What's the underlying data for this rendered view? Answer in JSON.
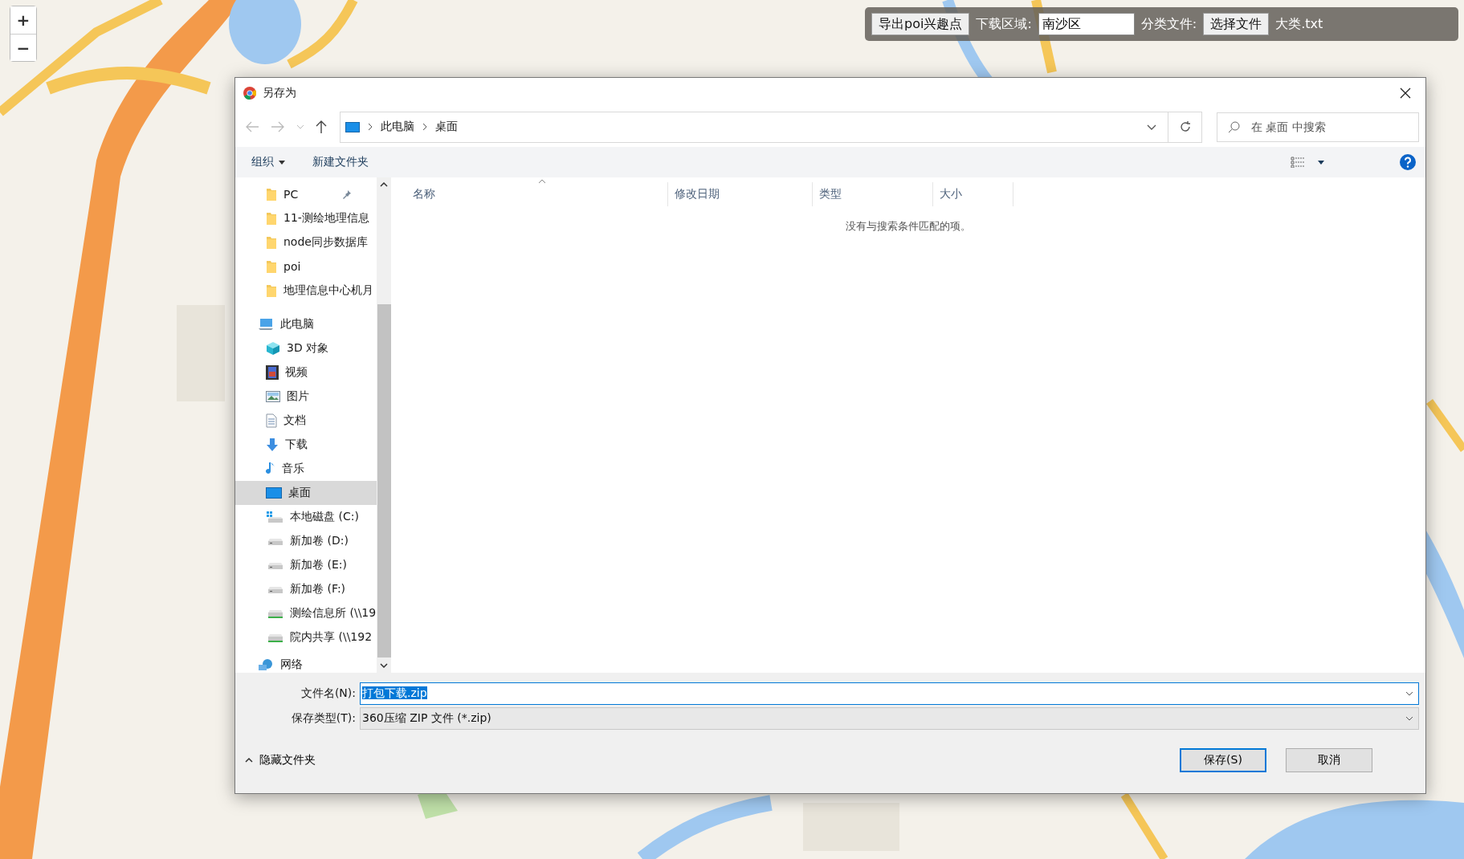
{
  "map_controls": {
    "zoom_in": "+",
    "zoom_out": "−"
  },
  "toolbar": {
    "export_button": "导出poi兴趣点",
    "region_label": "下载区域:",
    "region_value": "南沙区",
    "category_label": "分类文件:",
    "choose_button": "选择文件",
    "file_name": "大类.txt"
  },
  "dialog": {
    "title": "另存为",
    "breadcrumb": [
      "此电脑",
      "桌面"
    ],
    "search": {
      "placeholder": "在 桌面 中搜索"
    },
    "commands": {
      "organize": "组织",
      "new_folder": "新建文件夹"
    },
    "quick_access": [
      {
        "label": "PC",
        "kind": "folder",
        "pinned": true,
        "selected": false
      },
      {
        "label": "11-测绘地理信息",
        "kind": "folder",
        "pinned": false,
        "selected": false
      },
      {
        "label": "node同步数据库",
        "kind": "folder",
        "pinned": false,
        "selected": false
      },
      {
        "label": "poi",
        "kind": "folder",
        "pinned": false,
        "selected": false
      },
      {
        "label": "地理信息中心机月",
        "kind": "folder",
        "pinned": false,
        "selected": false
      }
    ],
    "tree": [
      {
        "label": "此电脑",
        "kind": "computer",
        "selected": false,
        "children": [
          {
            "label": "3D 对象",
            "kind": "cube",
            "selected": false
          },
          {
            "label": "视频",
            "kind": "video",
            "selected": false
          },
          {
            "label": "图片",
            "kind": "picture",
            "selected": false
          },
          {
            "label": "文档",
            "kind": "document",
            "selected": false
          },
          {
            "label": "下载",
            "kind": "download",
            "selected": false
          },
          {
            "label": "音乐",
            "kind": "music",
            "selected": false
          },
          {
            "label": "桌面",
            "kind": "desktop",
            "selected": true
          },
          {
            "label": "本地磁盘 (C:)",
            "kind": "system-drive",
            "selected": false
          },
          {
            "label": "新加卷 (D:)",
            "kind": "drive",
            "selected": false
          },
          {
            "label": "新加卷 (E:)",
            "kind": "drive",
            "selected": false
          },
          {
            "label": "新加卷 (F:)",
            "kind": "drive",
            "selected": false
          },
          {
            "label": "测绘信息所 (\\\\19",
            "kind": "network-drive",
            "selected": false
          },
          {
            "label": "院内共享 (\\\\192",
            "kind": "network-drive",
            "selected": false
          }
        ]
      },
      {
        "label": "网络",
        "kind": "network",
        "selected": false
      }
    ],
    "columns": [
      "名称",
      "修改日期",
      "类型",
      "大小"
    ],
    "empty_message": "没有与搜索条件匹配的项。",
    "file_name": {
      "label": "文件名(N):",
      "value": "打包下载.zip"
    },
    "file_type": {
      "label": "保存类型(T):",
      "value": "360压缩 ZIP 文件 (*.zip)"
    },
    "hide_folders": "隐藏文件夹",
    "buttons": [
      {
        "label": "保存(S)",
        "kind": "primary"
      },
      {
        "label": "取消",
        "kind": "normal"
      }
    ]
  }
}
